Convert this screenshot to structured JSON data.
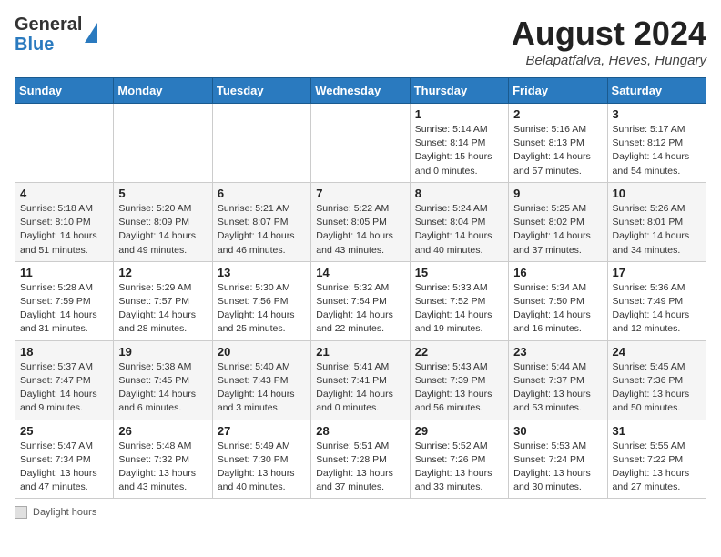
{
  "header": {
    "logo_general": "General",
    "logo_blue": "Blue",
    "month_year": "August 2024",
    "location": "Belapatfalva, Heves, Hungary"
  },
  "days_of_week": [
    "Sunday",
    "Monday",
    "Tuesday",
    "Wednesday",
    "Thursday",
    "Friday",
    "Saturday"
  ],
  "weeks": [
    [
      {
        "day": "",
        "info": ""
      },
      {
        "day": "",
        "info": ""
      },
      {
        "day": "",
        "info": ""
      },
      {
        "day": "",
        "info": ""
      },
      {
        "day": "1",
        "info": "Sunrise: 5:14 AM\nSunset: 8:14 PM\nDaylight: 15 hours\nand 0 minutes."
      },
      {
        "day": "2",
        "info": "Sunrise: 5:16 AM\nSunset: 8:13 PM\nDaylight: 14 hours\nand 57 minutes."
      },
      {
        "day": "3",
        "info": "Sunrise: 5:17 AM\nSunset: 8:12 PM\nDaylight: 14 hours\nand 54 minutes."
      }
    ],
    [
      {
        "day": "4",
        "info": "Sunrise: 5:18 AM\nSunset: 8:10 PM\nDaylight: 14 hours\nand 51 minutes."
      },
      {
        "day": "5",
        "info": "Sunrise: 5:20 AM\nSunset: 8:09 PM\nDaylight: 14 hours\nand 49 minutes."
      },
      {
        "day": "6",
        "info": "Sunrise: 5:21 AM\nSunset: 8:07 PM\nDaylight: 14 hours\nand 46 minutes."
      },
      {
        "day": "7",
        "info": "Sunrise: 5:22 AM\nSunset: 8:05 PM\nDaylight: 14 hours\nand 43 minutes."
      },
      {
        "day": "8",
        "info": "Sunrise: 5:24 AM\nSunset: 8:04 PM\nDaylight: 14 hours\nand 40 minutes."
      },
      {
        "day": "9",
        "info": "Sunrise: 5:25 AM\nSunset: 8:02 PM\nDaylight: 14 hours\nand 37 minutes."
      },
      {
        "day": "10",
        "info": "Sunrise: 5:26 AM\nSunset: 8:01 PM\nDaylight: 14 hours\nand 34 minutes."
      }
    ],
    [
      {
        "day": "11",
        "info": "Sunrise: 5:28 AM\nSunset: 7:59 PM\nDaylight: 14 hours\nand 31 minutes."
      },
      {
        "day": "12",
        "info": "Sunrise: 5:29 AM\nSunset: 7:57 PM\nDaylight: 14 hours\nand 28 minutes."
      },
      {
        "day": "13",
        "info": "Sunrise: 5:30 AM\nSunset: 7:56 PM\nDaylight: 14 hours\nand 25 minutes."
      },
      {
        "day": "14",
        "info": "Sunrise: 5:32 AM\nSunset: 7:54 PM\nDaylight: 14 hours\nand 22 minutes."
      },
      {
        "day": "15",
        "info": "Sunrise: 5:33 AM\nSunset: 7:52 PM\nDaylight: 14 hours\nand 19 minutes."
      },
      {
        "day": "16",
        "info": "Sunrise: 5:34 AM\nSunset: 7:50 PM\nDaylight: 14 hours\nand 16 minutes."
      },
      {
        "day": "17",
        "info": "Sunrise: 5:36 AM\nSunset: 7:49 PM\nDaylight: 14 hours\nand 12 minutes."
      }
    ],
    [
      {
        "day": "18",
        "info": "Sunrise: 5:37 AM\nSunset: 7:47 PM\nDaylight: 14 hours\nand 9 minutes."
      },
      {
        "day": "19",
        "info": "Sunrise: 5:38 AM\nSunset: 7:45 PM\nDaylight: 14 hours\nand 6 minutes."
      },
      {
        "day": "20",
        "info": "Sunrise: 5:40 AM\nSunset: 7:43 PM\nDaylight: 14 hours\nand 3 minutes."
      },
      {
        "day": "21",
        "info": "Sunrise: 5:41 AM\nSunset: 7:41 PM\nDaylight: 14 hours\nand 0 minutes."
      },
      {
        "day": "22",
        "info": "Sunrise: 5:43 AM\nSunset: 7:39 PM\nDaylight: 13 hours\nand 56 minutes."
      },
      {
        "day": "23",
        "info": "Sunrise: 5:44 AM\nSunset: 7:37 PM\nDaylight: 13 hours\nand 53 minutes."
      },
      {
        "day": "24",
        "info": "Sunrise: 5:45 AM\nSunset: 7:36 PM\nDaylight: 13 hours\nand 50 minutes."
      }
    ],
    [
      {
        "day": "25",
        "info": "Sunrise: 5:47 AM\nSunset: 7:34 PM\nDaylight: 13 hours\nand 47 minutes."
      },
      {
        "day": "26",
        "info": "Sunrise: 5:48 AM\nSunset: 7:32 PM\nDaylight: 13 hours\nand 43 minutes."
      },
      {
        "day": "27",
        "info": "Sunrise: 5:49 AM\nSunset: 7:30 PM\nDaylight: 13 hours\nand 40 minutes."
      },
      {
        "day": "28",
        "info": "Sunrise: 5:51 AM\nSunset: 7:28 PM\nDaylight: 13 hours\nand 37 minutes."
      },
      {
        "day": "29",
        "info": "Sunrise: 5:52 AM\nSunset: 7:26 PM\nDaylight: 13 hours\nand 33 minutes."
      },
      {
        "day": "30",
        "info": "Sunrise: 5:53 AM\nSunset: 7:24 PM\nDaylight: 13 hours\nand 30 minutes."
      },
      {
        "day": "31",
        "info": "Sunrise: 5:55 AM\nSunset: 7:22 PM\nDaylight: 13 hours\nand 27 minutes."
      }
    ]
  ],
  "footer": {
    "label": "Daylight hours"
  }
}
